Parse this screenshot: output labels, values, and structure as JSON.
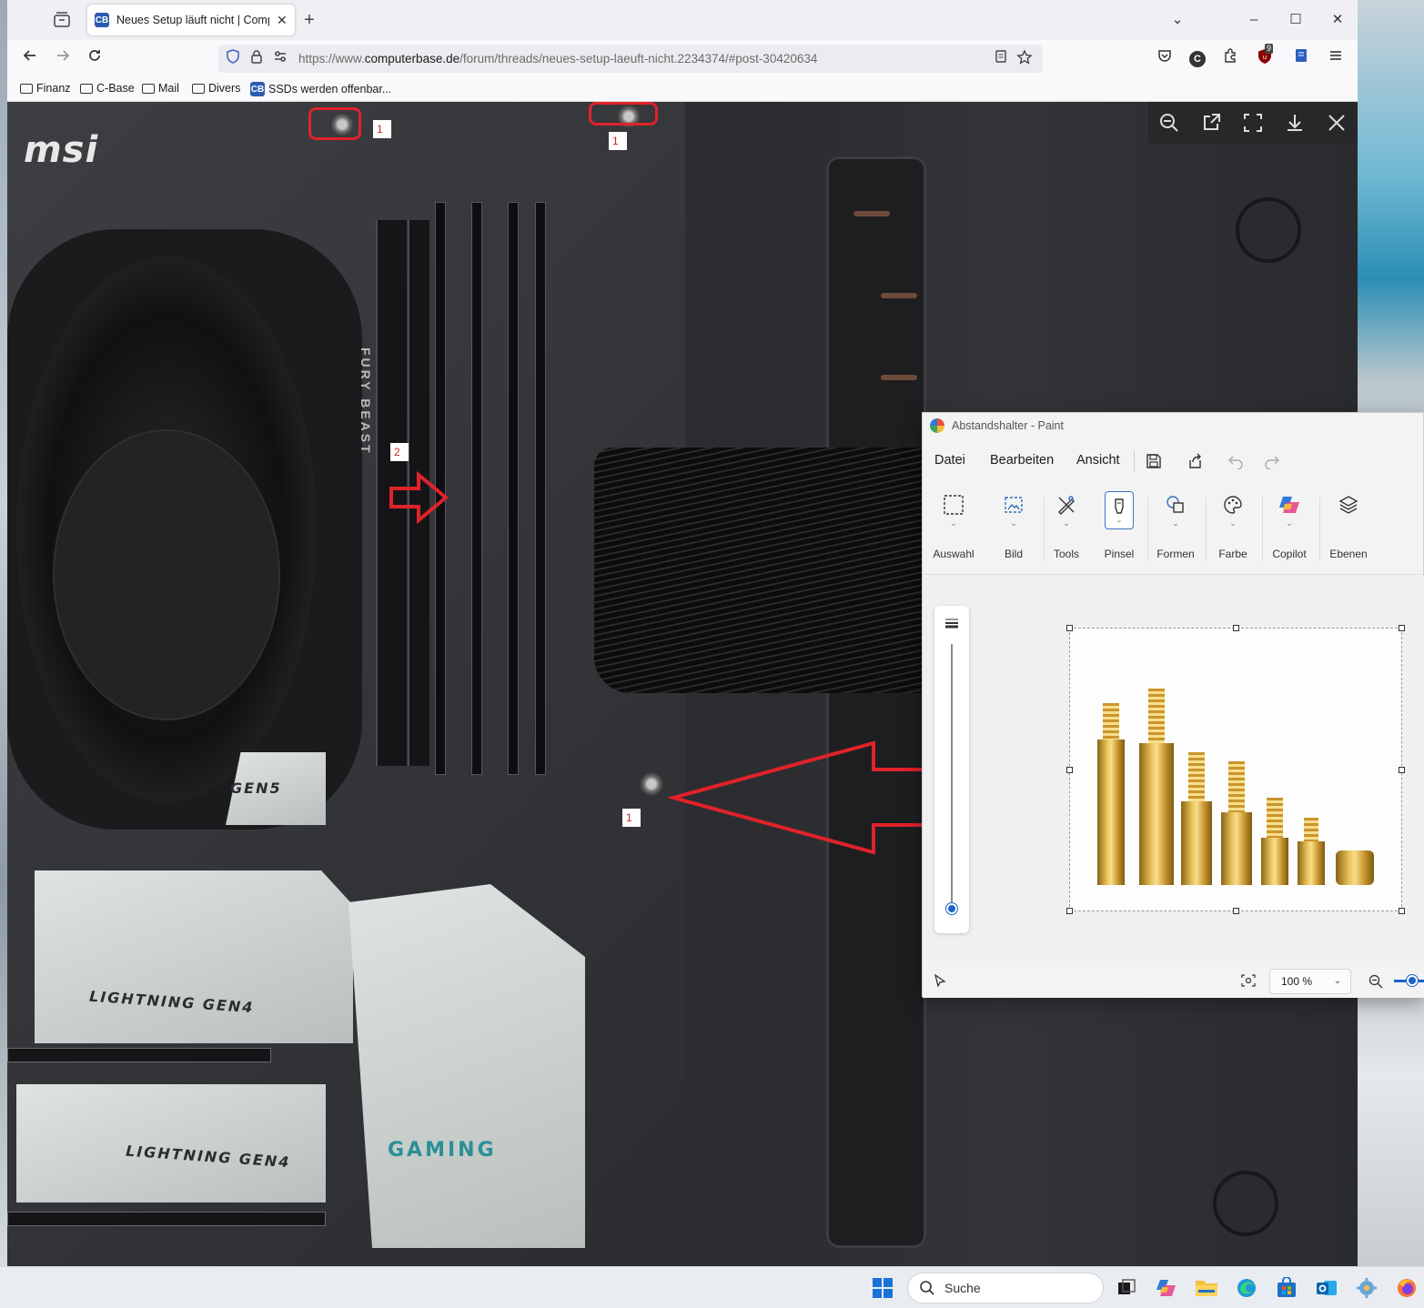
{
  "browser": {
    "tab": {
      "favicon": "CB",
      "title": "Neues Setup läuft nicht | Compu",
      "close": "✕"
    },
    "new_tab": "+",
    "window_controls": {
      "list": "⌄",
      "minimize": "–",
      "maximize": "☐",
      "close": "✕"
    },
    "url": {
      "prefix": "https://www.",
      "domain": "computerbase.de",
      "path": "/forum/threads/neues-setup-laeuft-nicht.2234374/#post-30420634"
    },
    "toolbar_icons": [
      "pocket-icon",
      "account-icon",
      "extensions-icon",
      "ublock-icon",
      "reader-icon",
      "menu-icon"
    ],
    "ublock_badge": "9",
    "account_letter": "C",
    "bookmarks": [
      {
        "label": "Finanz",
        "type": "folder"
      },
      {
        "label": "C-Base",
        "type": "folder"
      },
      {
        "label": "Mail",
        "type": "folder"
      },
      {
        "label": "Divers",
        "type": "folder"
      },
      {
        "label": "SSDs werden offenbar...",
        "type": "page",
        "favicon": "CB"
      }
    ]
  },
  "photo": {
    "brand": "msi",
    "ram_label": "FURY BEAST",
    "heatsink_labels": [
      "LIGHTNING GEN4",
      "LIGHTNING GEN4",
      "GEN5"
    ],
    "gaming_label": "GAMING",
    "annotations": [
      "1",
      "1",
      "2",
      "1",
      "1"
    ]
  },
  "lightbox": {
    "buttons": [
      "zoom-out-icon",
      "open-external-icon",
      "fullscreen-icon",
      "download-icon",
      "close-icon"
    ]
  },
  "paint": {
    "title": "Abstandshalter - Paint",
    "menu": [
      "Datei",
      "Bearbeiten",
      "Ansicht"
    ],
    "tools": [
      "Auswahl",
      "Bild",
      "Tools",
      "Pinsel",
      "Formen",
      "Farbe",
      "Copilot",
      "Ebenen"
    ],
    "zoom": "100 %"
  },
  "taskbar": {
    "search_placeholder": "Suche"
  },
  "colors": {
    "annotation_red": "#e0222a",
    "paint_accent": "#1b63c7"
  }
}
